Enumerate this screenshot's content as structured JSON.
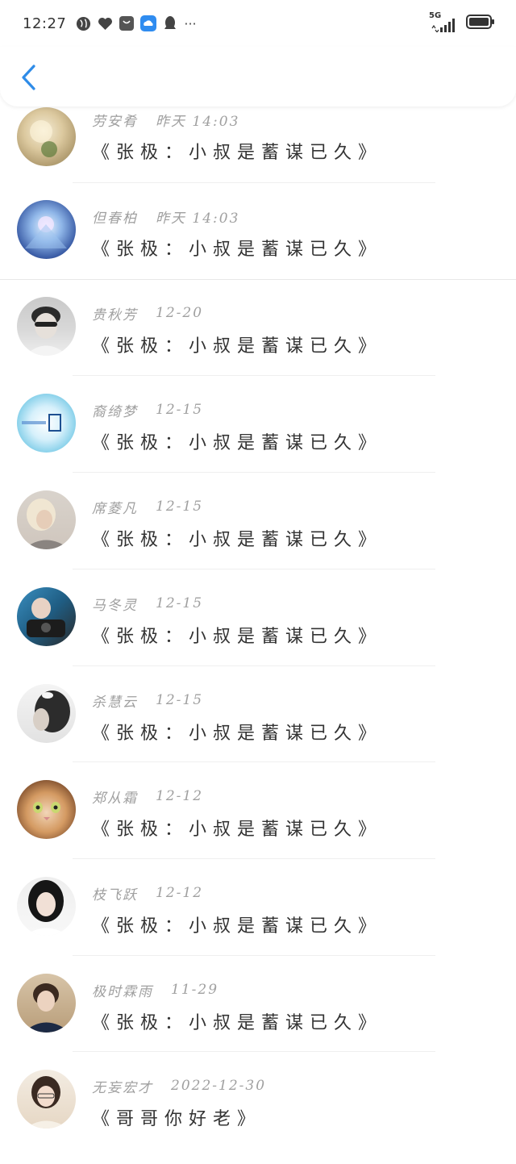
{
  "status_bar": {
    "time": "12:27",
    "more": "···",
    "network": "5G"
  },
  "header": {
    "back_icon": "chevron-left-icon"
  },
  "messages": [
    {
      "name": "劳安肴",
      "time": "昨天 14:03",
      "text": "《张极：小叔是蓄谋已久》",
      "avatar": "flowers"
    },
    {
      "name": "但春柏",
      "time": "昨天 14:03",
      "text": "《张极：小叔是蓄谋已久》",
      "avatar": "anime"
    },
    {
      "name": "贵秋芳",
      "time": "12-20",
      "text": "《张极：小叔是蓄谋已久》",
      "avatar": "boy-gray"
    },
    {
      "name": "裔绮梦",
      "time": "12-15",
      "text": "《张极：小叔是蓄谋已久》",
      "avatar": "blue-text"
    },
    {
      "name": "席菱凡",
      "time": "12-15",
      "text": "《张极：小叔是蓄谋已久》",
      "avatar": "blonde"
    },
    {
      "name": "马冬灵",
      "time": "12-15",
      "text": "《张极：小叔是蓄谋已久》",
      "avatar": "boy-dark"
    },
    {
      "name": "杀慧云",
      "time": "12-15",
      "text": "《张极：小叔是蓄谋已久》",
      "avatar": "dark-hair"
    },
    {
      "name": "郑从霜",
      "time": "12-12",
      "text": "《张极：小叔是蓄谋已久》",
      "avatar": "cat"
    },
    {
      "name": "枝飞跃",
      "time": "12-12",
      "text": "《张极：小叔是蓄谋已久》",
      "avatar": "girl"
    },
    {
      "name": "极时霖雨",
      "time": "11-29",
      "text": "《张极：小叔是蓄谋已久》",
      "avatar": "boy-brown"
    },
    {
      "name": "无妄宏才",
      "time": "2022-12-30",
      "text": "《哥哥你好老》",
      "avatar": "girl-glasses"
    }
  ]
}
